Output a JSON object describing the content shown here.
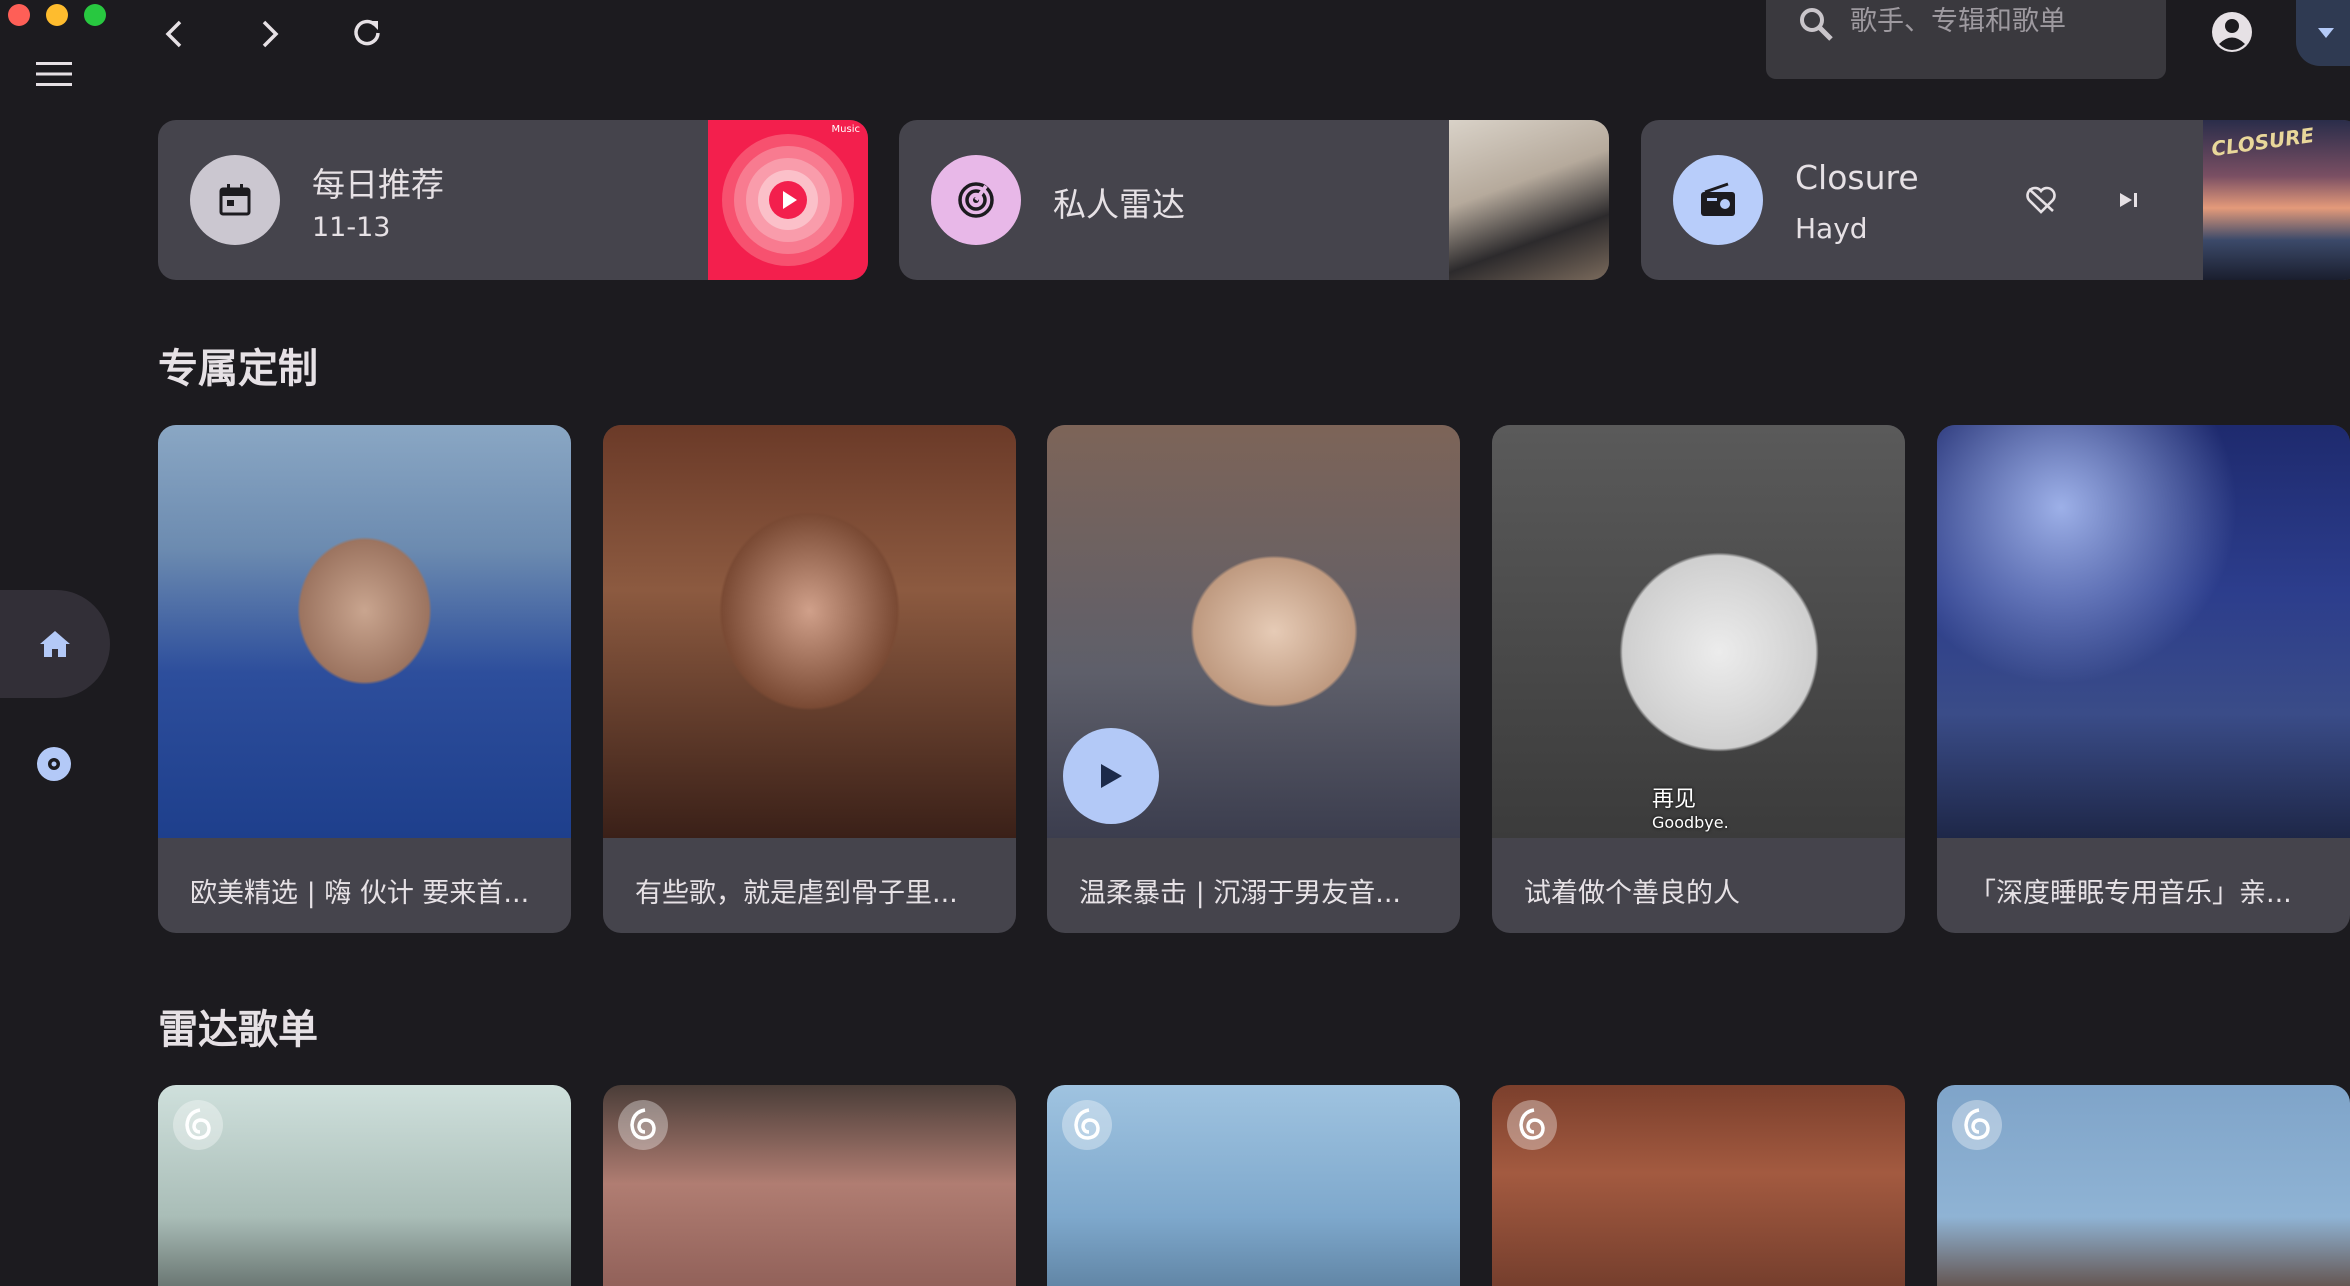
{
  "search": {
    "placeholder": "歌手、专辑和歌单"
  },
  "top_cards": {
    "daily": {
      "title": "每日推荐",
      "date": "11-13",
      "badge": "Music"
    },
    "radar": {
      "title": "私人雷达"
    },
    "fm": {
      "title": "Closure",
      "artist": "Hayd",
      "art_text": "CLOSURE"
    }
  },
  "sections": {
    "custom": {
      "title": "专属定制",
      "playlists": [
        {
          "title": "欧美精选 | 嗨 伙计 要来首..."
        },
        {
          "title": "有些歌，就是虐到骨子里..."
        },
        {
          "title": "温柔暴击 | 沉溺于男友音..."
        },
        {
          "title": "试着做个善良的人",
          "cover_text_1": "再见",
          "cover_text_2": "Goodbye."
        },
        {
          "title": "「深度睡眠专用音乐」亲..."
        }
      ]
    },
    "radar": {
      "title": "雷达歌单"
    }
  },
  "colors": {
    "background": "#1c1b1f",
    "card": "#45444c",
    "accent_blue": "#b3c9f7",
    "apple_music_red": "#f31f4d"
  }
}
